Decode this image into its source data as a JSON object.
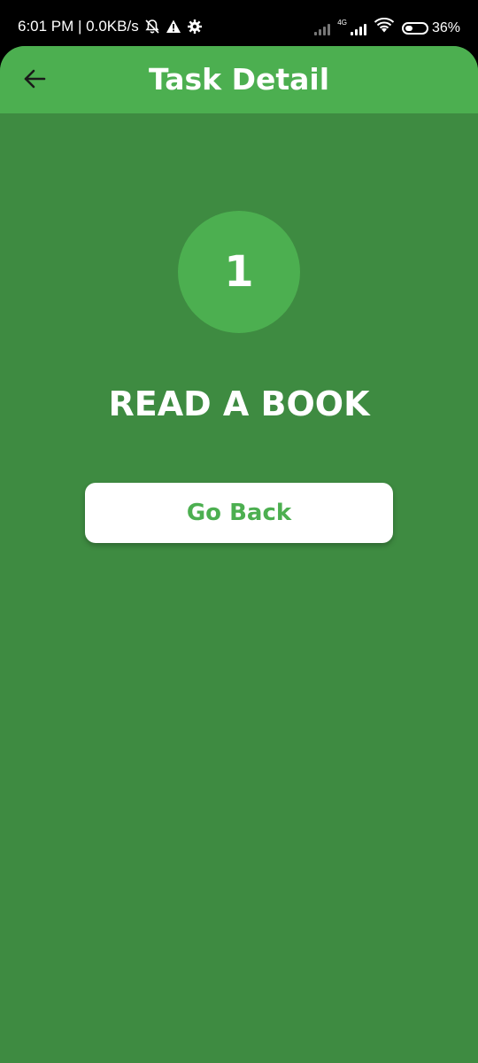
{
  "status_bar": {
    "time_and_speed": "6:01 PM | 0.0KB/s",
    "network_label": "4G",
    "battery_percent": "36%",
    "battery_level": 0.36
  },
  "app_bar": {
    "title": "Task Detail"
  },
  "task": {
    "number": "1",
    "title": "READ A BOOK"
  },
  "actions": {
    "go_back_label": "Go Back"
  },
  "colors": {
    "app_bar_bg": "#4caf50",
    "page_bg": "#3e8b41",
    "accent": "#4caf50",
    "button_bg": "#ffffff"
  },
  "icons": {
    "back": "arrow-left-icon",
    "muted": "bell-off-icon",
    "warning": "warning-icon",
    "settings": "gear-icon",
    "signal": "signal-icon",
    "wifi": "wifi-icon",
    "battery": "battery-icon"
  }
}
